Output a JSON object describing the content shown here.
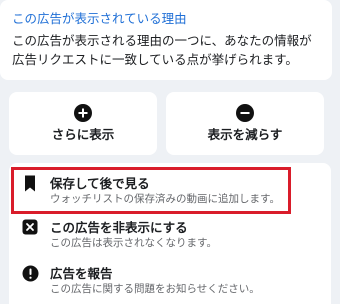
{
  "reason": {
    "link": "この広告が表示されている理由",
    "text": "この広告が表示される理由の一つに、あなたの情報が広告リクエストに一致している点が挙げられます。"
  },
  "actions": {
    "show_more": {
      "label": "さらに表示",
      "icon": "plus-circle-icon"
    },
    "show_less": {
      "label": "表示を減らす",
      "icon": "minus-circle-icon"
    }
  },
  "menu": {
    "save": {
      "title": "保存して後で見る",
      "subtitle": "ウォッチリストの保存済みの動画に追加します。",
      "icon": "bookmark-icon"
    },
    "hide": {
      "title": "この広告を非表示にする",
      "subtitle": "この広告は表示されなくなります。",
      "icon": "close-box-icon"
    },
    "report": {
      "title": "広告を報告",
      "subtitle": "この広告に関する問題をお知らせください。",
      "icon": "alert-icon"
    }
  },
  "colors": {
    "link": "#1f6fd6",
    "highlight": "#d91c2a",
    "background": "#eef1f5"
  }
}
